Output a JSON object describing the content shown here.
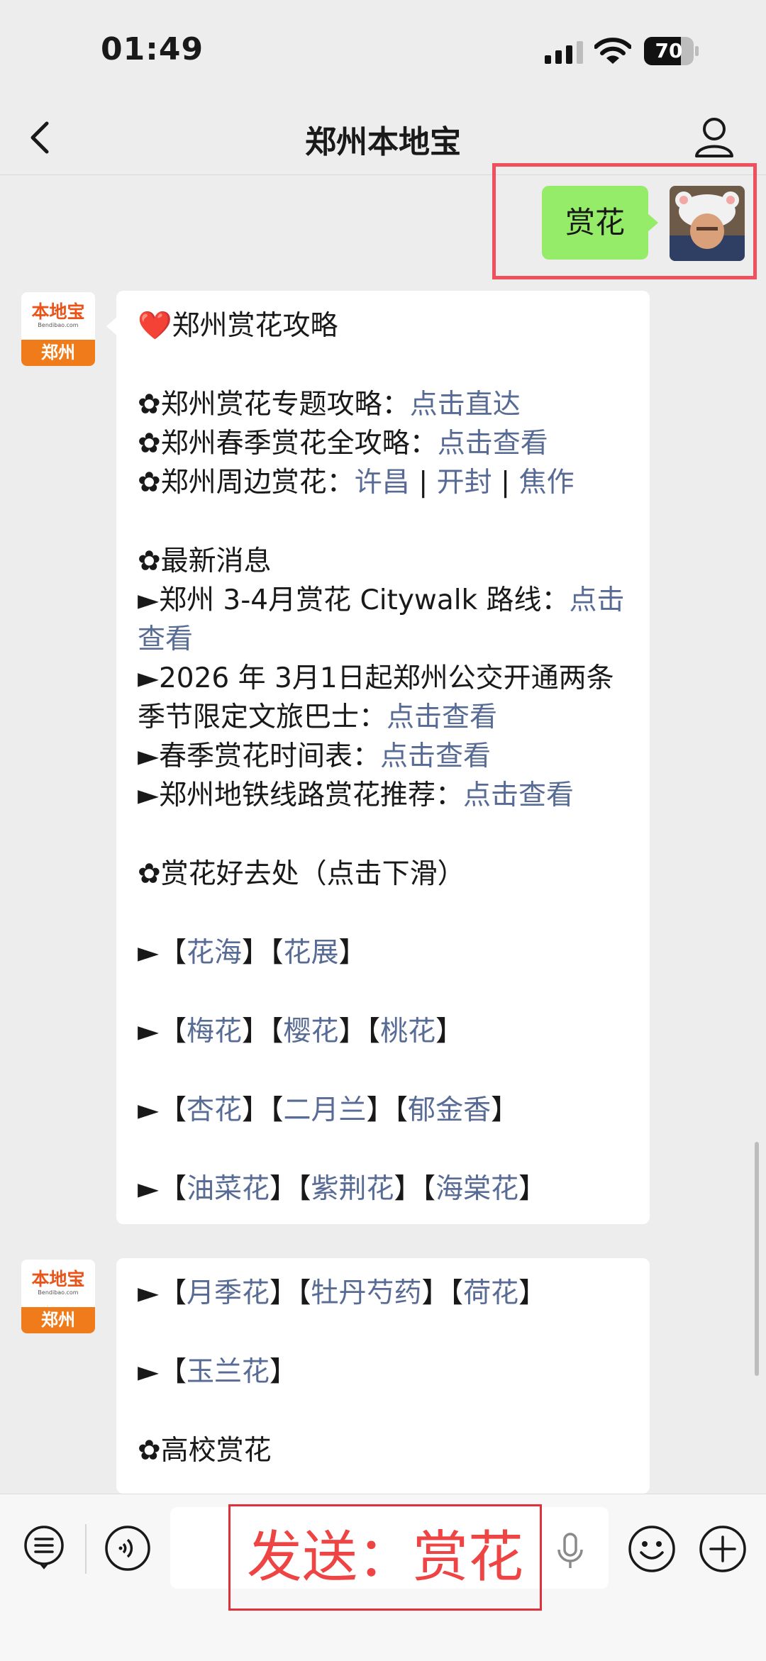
{
  "status": {
    "time": "01:49",
    "battery": "70"
  },
  "nav": {
    "title": "郑州本地宝"
  },
  "user_message": {
    "text": "赏花"
  },
  "bot": {
    "brand": "本地宝",
    "url": "Bendibao.com",
    "city": "郑州"
  },
  "message1": {
    "heading": "❤️郑州赏花攻略",
    "guide1_label": "✿郑州赏花专题攻略：",
    "guide1_link": "点击直达",
    "guide2_label": "✿郑州春季赏花全攻略：",
    "guide2_link": "点击查看",
    "guide3_label": "✿郑州周边赏花：",
    "nearby": [
      "许昌",
      "开封",
      "焦作"
    ],
    "separator": " | ",
    "news_heading": "✿最新消息",
    "news1_text": "►郑州 3-4月赏花 Citywalk 路线：",
    "news1_link": "点击查看",
    "news2_text": "►2026 年 3月1日起郑州公交开通两条季节限定文旅巴士：",
    "news2_link": "点击查看",
    "news3_text": "►春季赏花时间表：",
    "news3_link": "点击查看",
    "news4_text": "►郑州地铁线路赏花推荐：",
    "news4_link": "点击查看",
    "places_heading": "✿赏花好去处（点击下滑）",
    "rows": [
      [
        "花海",
        "花展"
      ],
      [
        "梅花",
        "樱花",
        "桃花"
      ],
      [
        "杏花",
        "二月兰",
        "郁金香"
      ],
      [
        "油菜花",
        "紫荆花",
        "海棠花"
      ]
    ]
  },
  "message2": {
    "rows": [
      [
        "月季花",
        "牡丹芍药",
        "荷花"
      ],
      [
        "玉兰花"
      ]
    ],
    "campus_heading": "✿高校赏花"
  },
  "bottom": {
    "send_label": "发送：赏花"
  },
  "colors": {
    "link": "#576b95",
    "bubble_green": "#95ec69",
    "highlight": "#f04f5c",
    "background": "#ededed"
  }
}
